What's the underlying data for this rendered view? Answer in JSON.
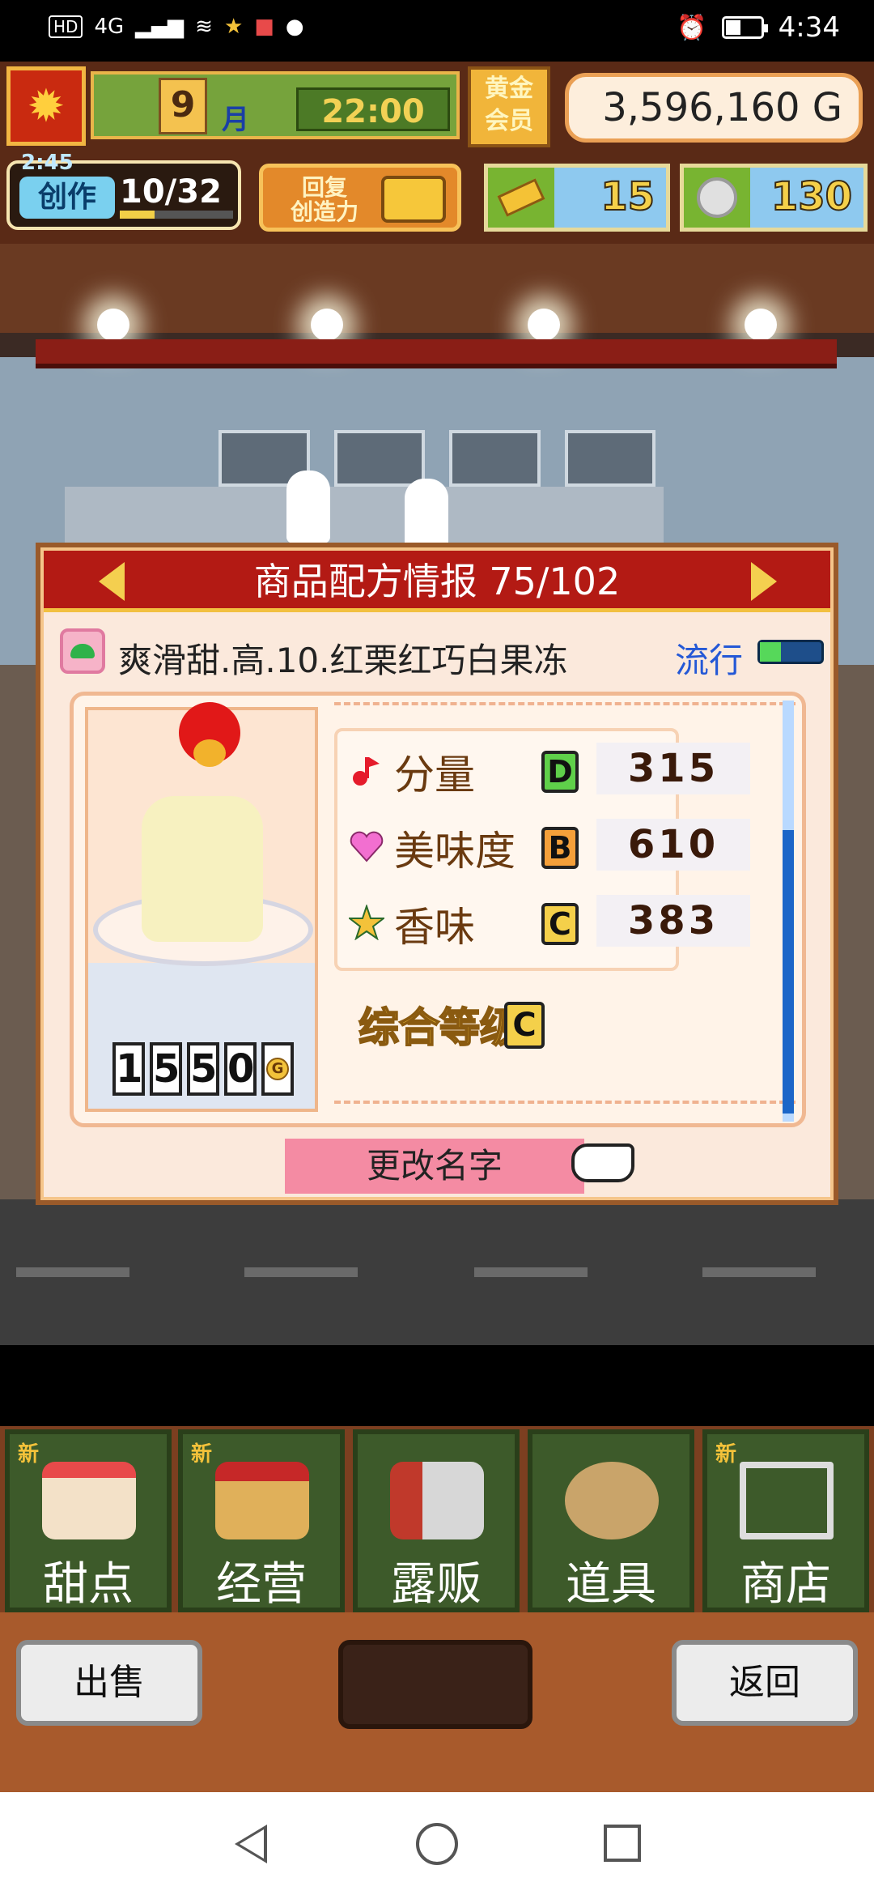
{
  "status_bar": {
    "network_badge": "HD",
    "network_type": "4G",
    "time": "4:34"
  },
  "hud": {
    "month_value": "9",
    "month_label": "月",
    "time": "22:00",
    "gold_member_label": "黄金\n会员",
    "money": "3,596,160 G",
    "create_timer": "2:45",
    "create_label": "创作",
    "create_value": "10/32",
    "restore_label": "回复\n创造力",
    "tickets": "15",
    "medals": "130"
  },
  "recipe_panel": {
    "title": "商品配方情报 75/102",
    "product_name": "爽滑甜.高.10.红栗红巧白果冻",
    "trend_label": "流行",
    "trend_level": 0.34,
    "price_digits": [
      "1",
      "5",
      "5",
      "0"
    ],
    "price_currency_icon": "G",
    "stats": [
      {
        "icon": "music-note-icon",
        "label": "分量",
        "grade": "D",
        "value": "315"
      },
      {
        "icon": "heart-icon",
        "label": "美味度",
        "grade": "B",
        "value": "610"
      },
      {
        "icon": "star-icon",
        "label": "香味",
        "grade": "C",
        "value": "383"
      }
    ],
    "overall_label": "综合等级",
    "overall_grade": "C",
    "rename_label": "更改名字"
  },
  "menu": {
    "items": [
      {
        "label": "甜点",
        "new": "新"
      },
      {
        "label": "经营",
        "new": "新"
      },
      {
        "label": "露贩",
        "new": ""
      },
      {
        "label": "道具",
        "new": ""
      },
      {
        "label": "商店",
        "new": "新"
      }
    ]
  },
  "bottom_bar": {
    "sell_label": "出售",
    "back_label": "返回"
  }
}
